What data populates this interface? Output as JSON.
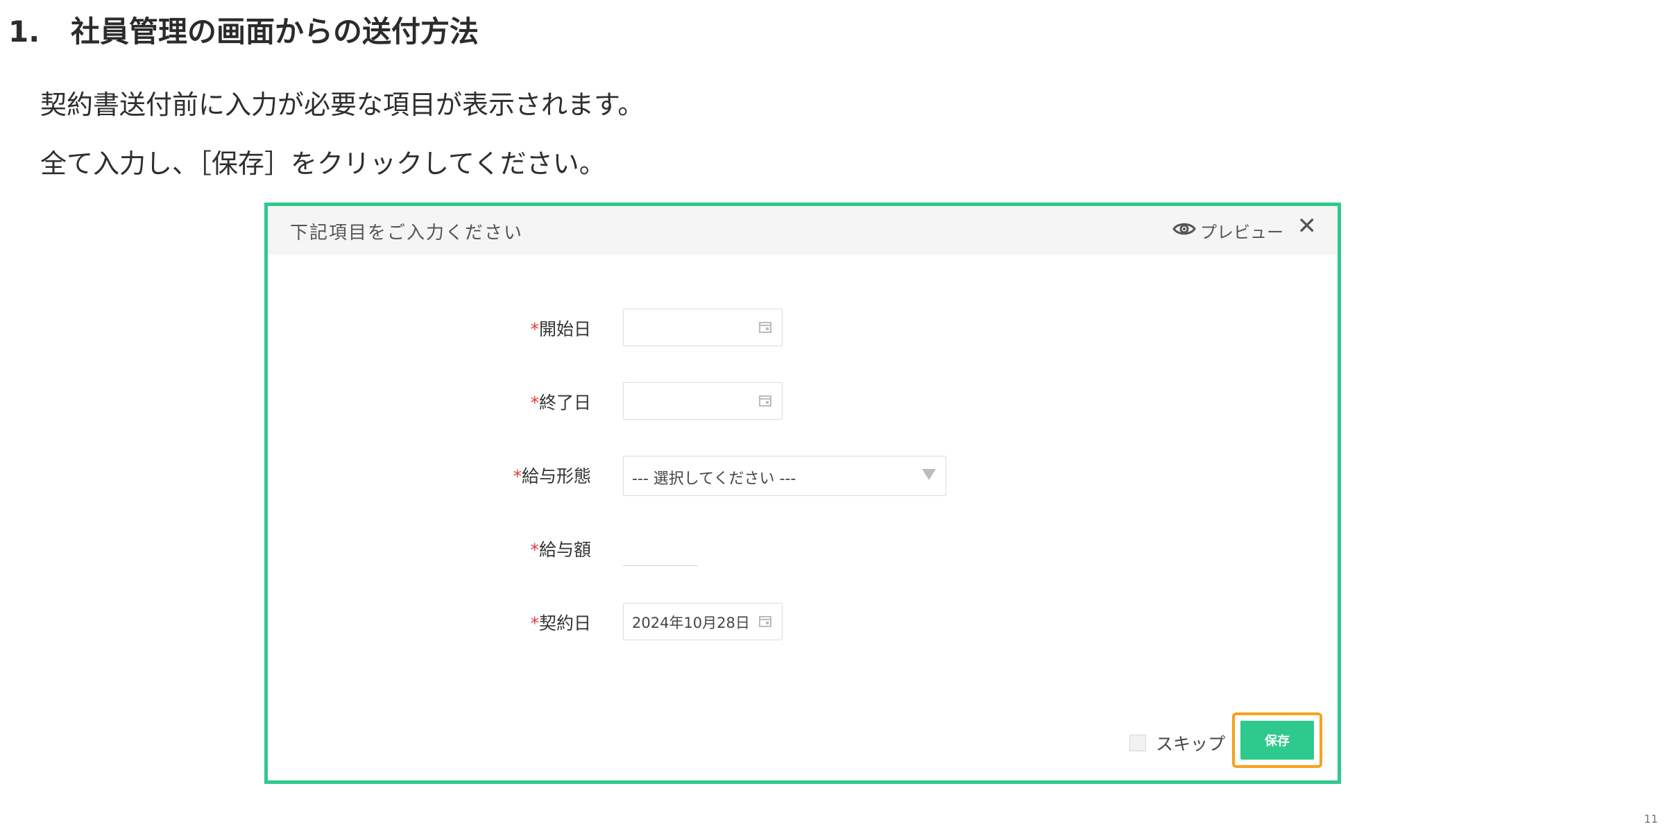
{
  "heading": {
    "number": "1.",
    "text": "社員管理の画面からの送付方法"
  },
  "intro": {
    "line1": "契約書送付前に入力が必要な項目が表示されます。",
    "line2": "全て入力し、［保存］をクリックしてください。"
  },
  "dialog": {
    "title": "下記項目をご入力ください",
    "preview_label": "プレビュー",
    "close_label": "✕",
    "required_mark": "*",
    "fields": {
      "start_date": {
        "label": "開始日",
        "value": ""
      },
      "end_date": {
        "label": "終了日",
        "value": ""
      },
      "pay_type": {
        "label": "給与形態",
        "value": "--- 選択してください ---"
      },
      "pay_amount": {
        "label": "給与額",
        "value": ""
      },
      "contract_date": {
        "label": "契約日",
        "value": "2024年10月28日"
      }
    },
    "skip_label": "スキップ",
    "save_label": "保存"
  },
  "page_number": "11",
  "colors": {
    "accent": "#2ec98c",
    "highlight": "#f5a21b",
    "required": "#e23b3b"
  }
}
